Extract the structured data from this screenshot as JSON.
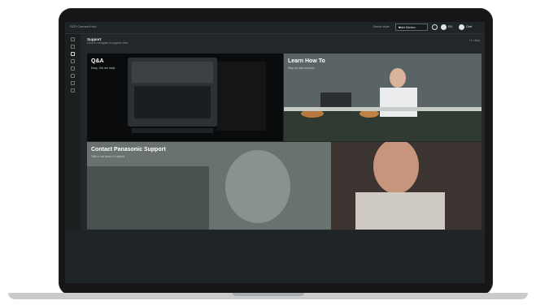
{
  "app": {
    "title": "SZR Connect Hub"
  },
  "header": {
    "device_label": "Device Mode",
    "device_value": "Main Kitchen",
    "language": "EN",
    "user": "Chef"
  },
  "page": {
    "title": "Support",
    "subtitle": "Click to navigate to support view",
    "tag": "+1 Links"
  },
  "cards": {
    "qa": {
      "title": "Q&A",
      "subtitle": "Easy, Get me help!"
    },
    "learn": {
      "title": "Learn How To",
      "subtitle": "Step by step tutorials"
    },
    "contact": {
      "title": "Contact Panasonic Support",
      "subtitle": "Talk to our team of experts"
    }
  },
  "colors": {
    "accent": "#1fa0d6",
    "topbar": "#1f2526",
    "sidebar": "#1a1f20"
  }
}
